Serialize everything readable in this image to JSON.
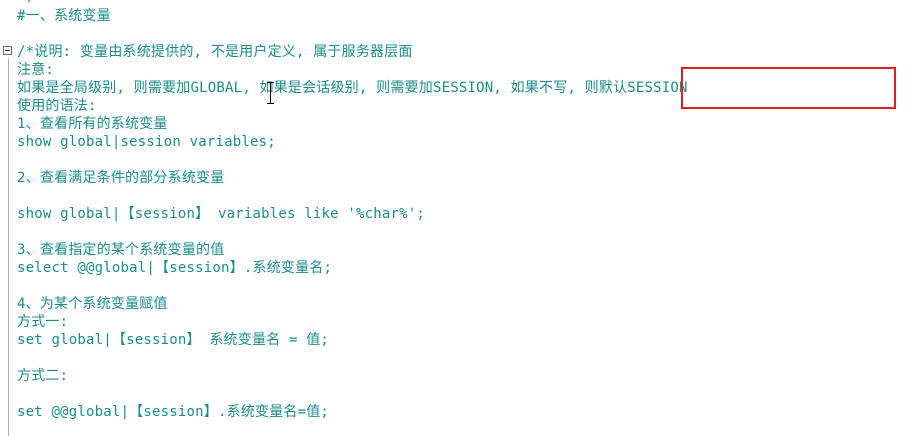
{
  "editor": {
    "partial_top_text": "/",
    "lines": [
      "#一、系统变量",
      "",
      "/*说明: 变量由系统提供的, 不是用户定义, 属于服务器层面",
      "注意:",
      "如果是全局级别, 则需要加GLOBAL, 如果是会话级别, 则需要加SESSION, 如果不写, 则默认SESSION",
      "使用的语法:",
      "1、查看所有的系统变量",
      "show global|session variables;",
      "",
      "2、查看满足条件的部分系统变量",
      "",
      "show global|【session】 variables like '%char%';",
      "",
      "3、查看指定的某个系统变量的值",
      "select @@global|【session】.系统变量名;",
      "",
      "4、为某个系统变量赋值",
      "方式一:",
      "set global|【session】 系统变量名 = 值;",
      "",
      "方式二:",
      "",
      "set @@global|【session】.系统变量名=值;"
    ]
  },
  "colors": {
    "text": "#1a8c8c",
    "highlight_border": "#e02020",
    "background": "#ffffff"
  },
  "icons": {
    "fold": "fold-minus-icon",
    "cursor": "text-cursor-icon"
  }
}
